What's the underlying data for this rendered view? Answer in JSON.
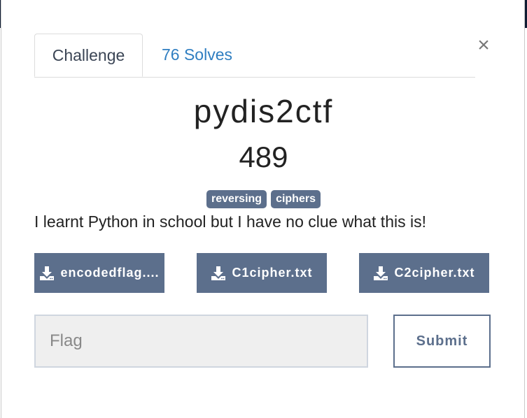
{
  "tabs": [
    {
      "label": "Challenge"
    },
    {
      "label": "76 Solves"
    }
  ],
  "close_label": "×",
  "challenge": {
    "name": "pydis2ctf",
    "value": "489",
    "tags": [
      "reversing",
      "ciphers"
    ],
    "description": "I learnt Python in school but I have no clue what this is!"
  },
  "files": [
    {
      "label": "encodedflag....",
      "icon": "download-icon"
    },
    {
      "label": "C1cipher.txt",
      "icon": "download-icon"
    },
    {
      "label": "C2cipher.txt",
      "icon": "download-icon"
    }
  ],
  "form": {
    "flag_placeholder": "Flag",
    "flag_value": "",
    "submit_label": "Submit"
  },
  "colors": {
    "accent": "#5c6f8c",
    "link": "#2f7ec1",
    "input_bg": "#efefef",
    "backdrop": "#0f1c33"
  }
}
